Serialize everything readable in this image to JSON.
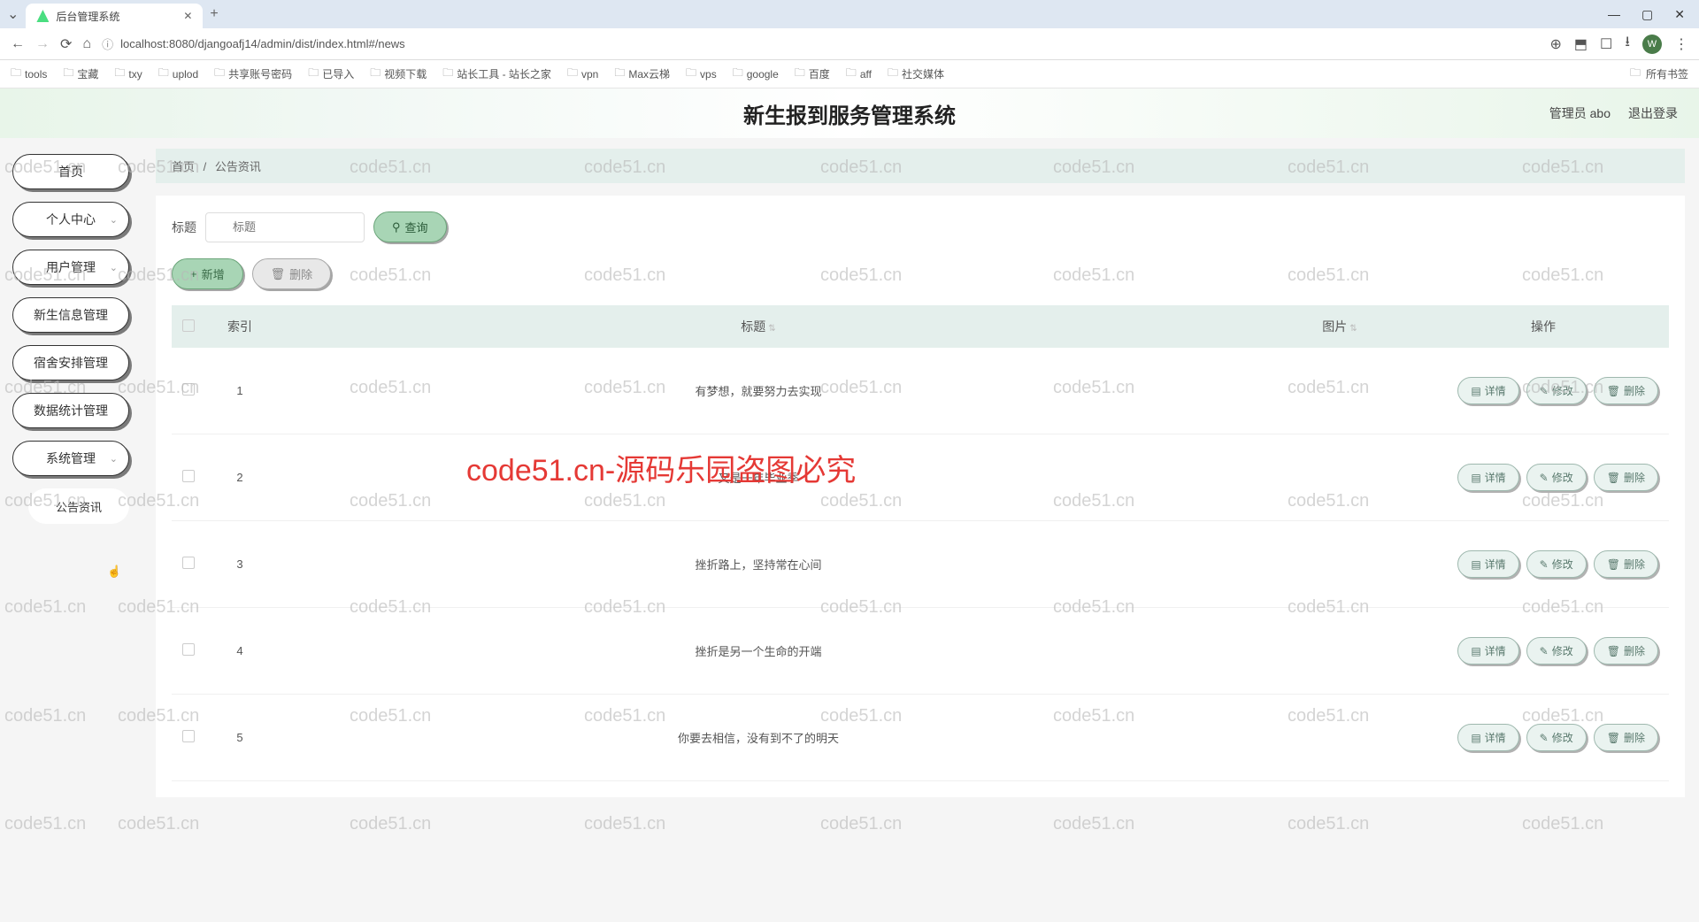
{
  "browser": {
    "tab_title": "后台管理系统",
    "url": "localhost:8080/djangoafj14/admin/dist/index.html#/news",
    "window_controls": {
      "min": "—",
      "max": "▢",
      "close": "✕"
    },
    "right_icons": {
      "key": "⊕",
      "ext": "⬒",
      "bookmark": "☐",
      "download": "⭳",
      "more": "⋮",
      "avatar": "W"
    }
  },
  "bookmarks": [
    {
      "label": "tools"
    },
    {
      "label": "宝藏"
    },
    {
      "label": "txy"
    },
    {
      "label": "uplod"
    },
    {
      "label": "共享账号密码"
    },
    {
      "label": "已导入"
    },
    {
      "label": "视频下载"
    },
    {
      "label": "站长工具 - 站长之家"
    },
    {
      "label": "vpn"
    },
    {
      "label": "Max云梯"
    },
    {
      "label": "vps"
    },
    {
      "label": "google"
    },
    {
      "label": "百度"
    },
    {
      "label": "aff"
    },
    {
      "label": "社交媒体"
    }
  ],
  "bookmarks_all": "所有书签",
  "header": {
    "title": "新生报到服务管理系统",
    "user_label": "管理员 abo",
    "logout": "退出登录"
  },
  "sidebar": {
    "items": [
      {
        "label": "首页",
        "expandable": false
      },
      {
        "label": "个人中心",
        "expandable": true
      },
      {
        "label": "用户管理",
        "expandable": true
      },
      {
        "label": "新生信息管理",
        "expandable": false
      },
      {
        "label": "宿舍安排管理",
        "expandable": false
      },
      {
        "label": "数据统计管理",
        "expandable": false
      },
      {
        "label": "系统管理",
        "expandable": true
      }
    ],
    "sub_item": "公告资讯"
  },
  "breadcrumb": {
    "home": "首页",
    "sep": "/",
    "current": "公告资讯"
  },
  "search": {
    "label": "标题",
    "placeholder": "标题",
    "button": "查询"
  },
  "actions": {
    "add": "新增",
    "delete": "删除"
  },
  "table": {
    "headers": {
      "index": "索引",
      "title": "标题",
      "image": "图片",
      "ops": "操作"
    },
    "ops": {
      "detail": "详情",
      "edit": "修改",
      "delete": "删除"
    },
    "rows": [
      {
        "index": "1",
        "title": "有梦想，就要努力去实现"
      },
      {
        "index": "2",
        "title": "又是一年毕业季"
      },
      {
        "index": "3",
        "title": "挫折路上，坚持常在心间"
      },
      {
        "index": "4",
        "title": "挫折是另一个生命的开端"
      },
      {
        "index": "5",
        "title": "你要去相信，没有到不了的明天"
      }
    ]
  },
  "watermark": "code51.cn",
  "big_watermark": "code51.cn-源码乐园盗图必究"
}
